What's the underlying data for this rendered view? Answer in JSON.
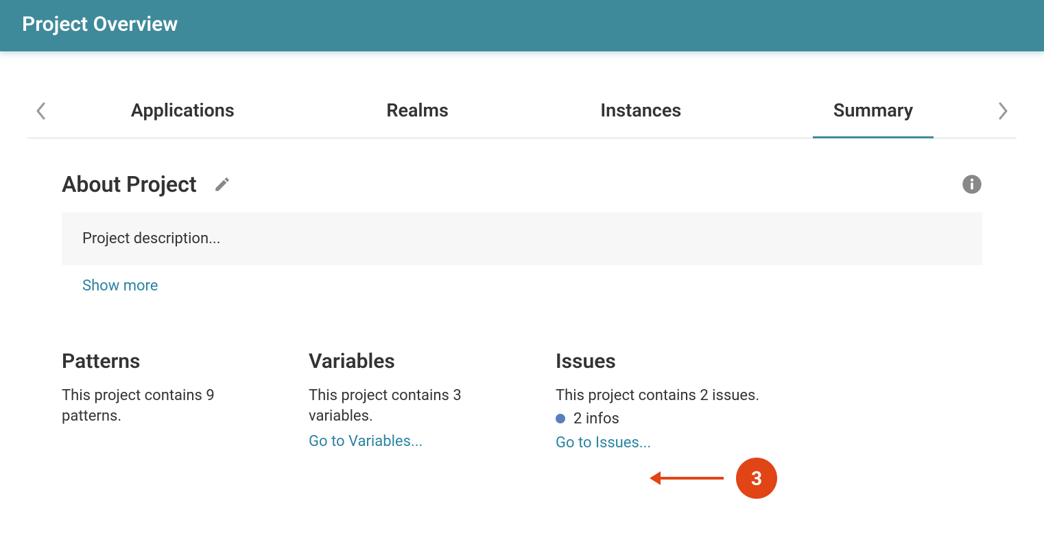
{
  "header": {
    "title": "Project Overview"
  },
  "tabs": {
    "items": [
      {
        "label": "Applications",
        "active": false
      },
      {
        "label": "Realms",
        "active": false
      },
      {
        "label": "Instances",
        "active": false
      },
      {
        "label": "Summary",
        "active": true
      }
    ]
  },
  "about": {
    "title": "About Project",
    "description": "Project description...",
    "show_more_label": "Show more"
  },
  "cards": {
    "patterns": {
      "title": "Patterns",
      "text": "This project contains 9 patterns."
    },
    "variables": {
      "title": "Variables",
      "text": "This project contains 3 variables.",
      "link": "Go to Variables..."
    },
    "issues": {
      "title": "Issues",
      "text": "This project contains 2 issues.",
      "info_count_label": "2 infos",
      "link": "Go to Issues..."
    }
  },
  "annotation": {
    "label": "3"
  }
}
